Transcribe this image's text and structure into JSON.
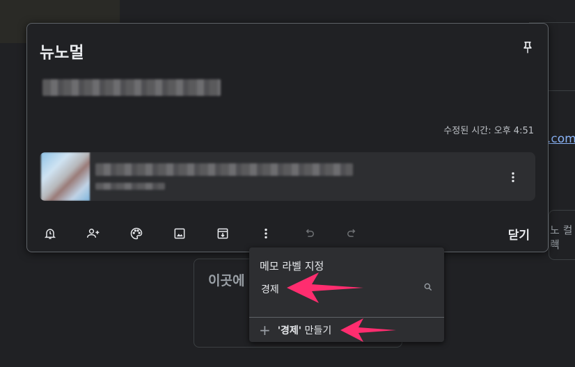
{
  "note": {
    "title": "뉴노멀",
    "modified": "수정된 시간: 오후 4:51",
    "close_label": "닫기"
  },
  "toolbar": {
    "icons": [
      "remind-me-icon",
      "collaborator-icon",
      "palette-icon",
      "add-image-icon",
      "archive-icon",
      "more-vert-icon",
      "undo-icon",
      "redo-icon"
    ]
  },
  "label_menu": {
    "title": "메모 라벨 지정",
    "search_value": "경제",
    "create_term": "'경제'",
    "create_suffix": " 만들기"
  },
  "background": {
    "link_text": ".com/",
    "right_text": "노 컬렉",
    "right_text2": "m",
    "bottom_card_text": "이곳에"
  },
  "colors": {
    "accent_arrow": "#ff2d6f",
    "dialog_bg": "#202124",
    "menu_bg": "#2d2e31"
  }
}
